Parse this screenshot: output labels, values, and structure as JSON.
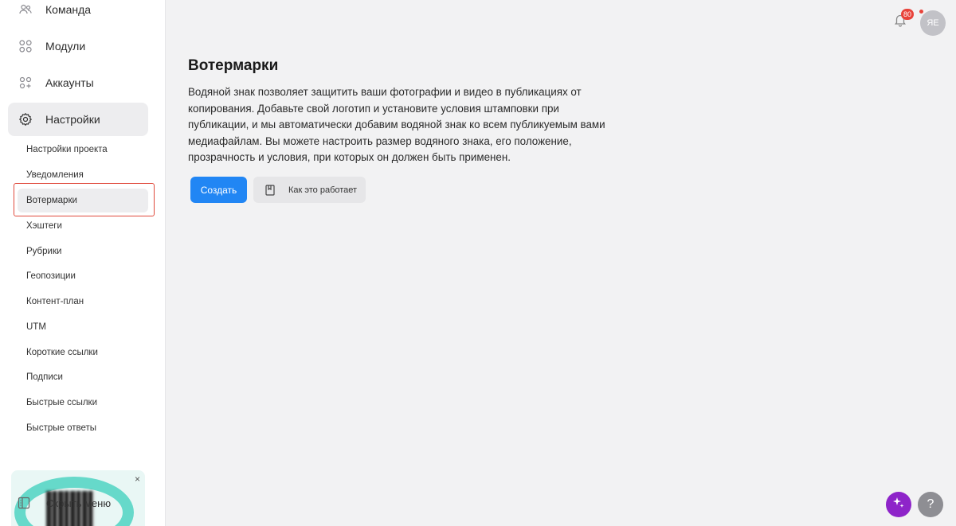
{
  "sidebar": {
    "nav": [
      {
        "label": "Команда",
        "icon": "users-icon"
      },
      {
        "label": "Модули",
        "icon": "modules-icon"
      },
      {
        "label": "Аккаунты",
        "icon": "accounts-icon"
      },
      {
        "label": "Настройки",
        "icon": "gear-icon"
      }
    ],
    "sub_items": [
      "Настройки проекта",
      "Уведомления",
      "Вотермарки",
      "Хэштеги",
      "Рубрики",
      "Геопозиции",
      "Контент-план",
      "UTM",
      "Короткие ссылки",
      "Подписи",
      "Быстрые ссылки",
      "Быстрые ответы"
    ],
    "hide_menu_label": "Скрыть меню",
    "promo_close": "×"
  },
  "main": {
    "title": "Вотермарки",
    "description": "Водяной знак позволяет защитить ваши фотографии и видео в публикациях от копирования. Добавьте свой логотип и установите условия штамповки при публикации, и мы автоматически добавим водяной знак ко всем публикуемым вами медиафайлам. Вы можете настроить размер водяного знака, его положение, прозрачность и условия, при которых он должен быть применен.",
    "create_label": "Создать",
    "how_label": "Как это работает"
  },
  "header": {
    "notifications_count": "80",
    "avatar_initials": "ЯЕ"
  },
  "footer": {
    "help_label": "?"
  },
  "colors": {
    "accent": "#2186f4",
    "badge": "#e8433a",
    "ai": "#8e24c9",
    "highlight": "#e04a3c"
  }
}
